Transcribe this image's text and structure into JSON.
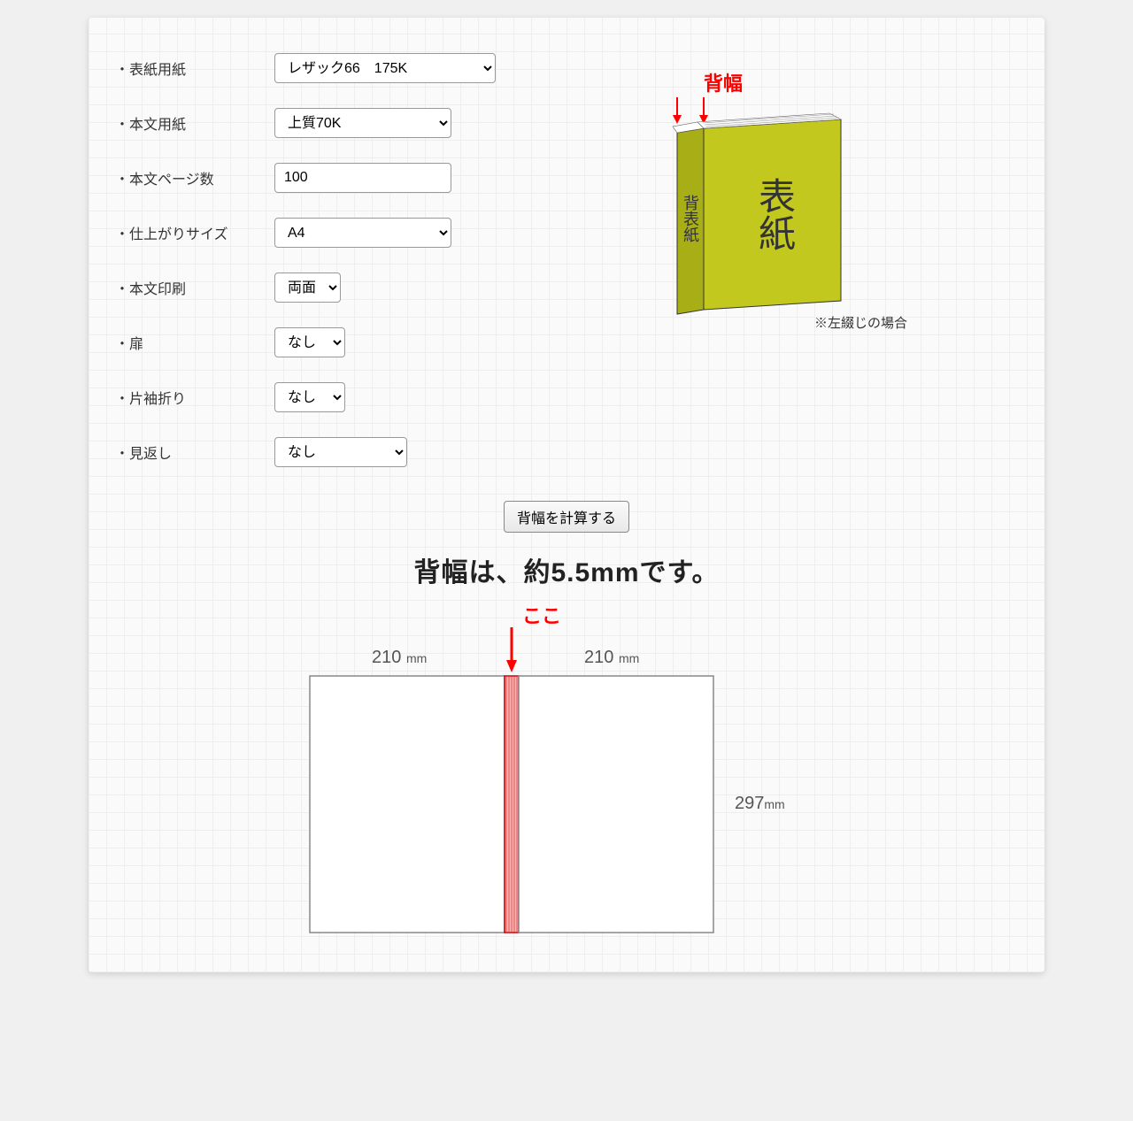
{
  "form": {
    "cover_paper": {
      "label": "・表紙用紙",
      "value": "レザック66　175K"
    },
    "body_paper": {
      "label": "・本文用紙",
      "value": "上質70K"
    },
    "page_count": {
      "label": "・本文ページ数",
      "value": "100"
    },
    "finish_size": {
      "label": "・仕上がりサイズ",
      "value": "A4"
    },
    "body_print": {
      "label": "・本文印刷",
      "value": "両面"
    },
    "tobira": {
      "label": "・扉",
      "value": "なし"
    },
    "flap": {
      "label": "・片袖折り",
      "value": "なし"
    },
    "mikaeshi": {
      "label": "・見返し",
      "value": "なし"
    }
  },
  "illustration": {
    "spine_label": "背幅",
    "spine_text": "背表紙",
    "front_text": "表紙",
    "note": "※左綴じの場合"
  },
  "action": {
    "calc_button": "背幅を計算する"
  },
  "result": {
    "text": "背幅は、約5.5mmです。",
    "here_label": "ここ",
    "width_label": "210",
    "width_unit": "mm",
    "height_label": "297",
    "height_unit": "mm"
  }
}
